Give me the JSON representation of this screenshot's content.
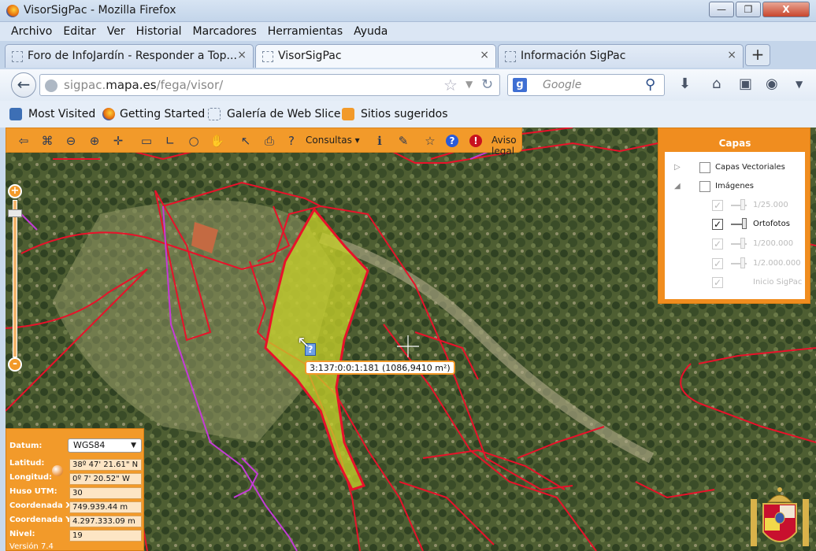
{
  "window": {
    "title": "VisorSigPac - Mozilla Firefox",
    "min_glyph": "—",
    "max_glyph": "❐",
    "close_glyph": "X"
  },
  "menu": [
    "Archivo",
    "Editar",
    "Ver",
    "Historial",
    "Marcadores",
    "Herramientas",
    "Ayuda"
  ],
  "tabs": [
    {
      "label": "Foro de InfoJardín - Responder a Top...",
      "close": "×"
    },
    {
      "label": "VisorSigPac",
      "close": "×"
    },
    {
      "label": "Información SigPac",
      "close": "×"
    }
  ],
  "newtab": "+",
  "url": {
    "host": "sigpac.",
    "domain": "mapa.es",
    "path": "/fega/visor/"
  },
  "search": {
    "engine": "g",
    "placeholder": "Google"
  },
  "bookmarks": [
    "Most Visited",
    "Getting Started",
    "Galería de Web Slice",
    "Sitios sugeridos"
  ],
  "sigpac_toolbar": {
    "consultas": "Consultas",
    "aviso_legal": "Aviso legal"
  },
  "capas": {
    "title": "Capas",
    "layers": [
      {
        "label": "Capas Vectoriales",
        "checked": false
      },
      {
        "label": "Imágenes",
        "checked": false
      }
    ],
    "images": [
      {
        "label": "1/25.000",
        "checked": true,
        "active": false
      },
      {
        "label": "Ortofotos",
        "checked": true,
        "active": true
      },
      {
        "label": "1/200.000",
        "checked": true,
        "active": false
      },
      {
        "label": "1/2.000.000",
        "checked": true,
        "active": false
      },
      {
        "label": "Inicio SigPac",
        "checked": true,
        "active": false
      }
    ]
  },
  "tooltip": "3:137:0:0:1:181 (1086,9410 m²)",
  "query_marker": "?",
  "coords": {
    "datum_label": "Datum:",
    "datum_value": "WGS84",
    "rows": [
      {
        "label": "Latitud:",
        "value": "38º 47' 21.61\" N"
      },
      {
        "label": "Longitud:",
        "value": "0º 7' 20.52\" W"
      },
      {
        "label": "Huso UTM:",
        "value": "30"
      },
      {
        "label": "Coordenada X:",
        "value": "749.939.44 m"
      },
      {
        "label": "Coordenada Y:",
        "value": "4.297.333.09 m"
      },
      {
        "label": "Nivel:",
        "value": "19"
      }
    ],
    "version": "Versión 7.4"
  },
  "colors": {
    "accent": "#f29a2a",
    "parcel_line": "#e8122a",
    "selected_fill": "#c8d22a",
    "path_line": "#c43bd6"
  }
}
